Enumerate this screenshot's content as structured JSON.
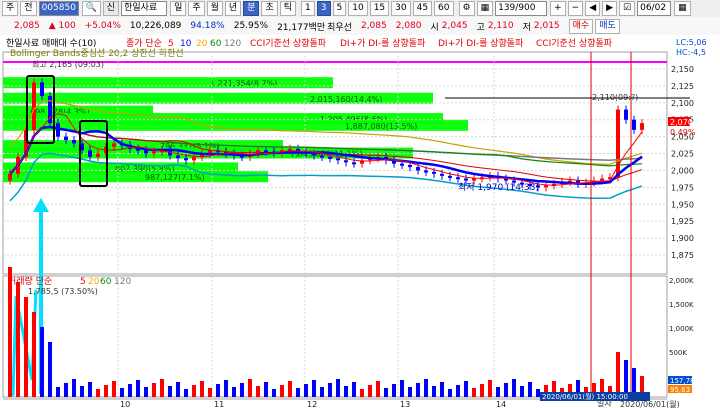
{
  "toolbar": {
    "market_label": "주",
    "exchange_label": "전",
    "code_value": "005850",
    "company_badge": "신",
    "company_name": "한일사료",
    "period_buttons": [
      "일",
      "주",
      "월",
      "년",
      "분",
      "초",
      "틱"
    ],
    "selected_period": "분",
    "minute_buttons": [
      "1",
      "3",
      "5",
      "10",
      "15",
      "30",
      "45",
      "60"
    ],
    "selected_minute": "3",
    "count_value": "139/900",
    "date_value": "06/02"
  },
  "quote": {
    "price": "2,085",
    "change": "▲ 100",
    "change_pct": "+5.04%",
    "volume": "10,226,089",
    "ratio": "94.18%",
    "turnover": "25.95%",
    "amount": "21,177백만",
    "min_label": "최우선",
    "ask": "2,085",
    "bid": "2,080",
    "open_label": "시",
    "open": "2,045",
    "high_label": "고",
    "high": "2,110",
    "low_label": "저",
    "low": "2,015",
    "buy_btn": "매수",
    "sell_btn": "매도"
  },
  "legend": {
    "title": "한일사료 매매대 수(10)",
    "ma_label": "종가 단순",
    "ma_periods": [
      "5",
      "10",
      "20",
      "60",
      "120"
    ],
    "indicators": [
      "CCI기준선 상향돌파",
      "DI+가 DI-를 상향돌파",
      "DI+가 DI-를 상향돌파",
      "CCI기준선 상향돌파"
    ],
    "bollinger": "Bollinger Bands중심선 20,2 상한선 하한선",
    "high_note": "최고 2,165 (09:03)",
    "low_note": "최저 1,970 (14:33)",
    "top_right": [
      "LC:5,06",
      "HC:-4,5"
    ]
  },
  "volume_legend": {
    "label": "거래량 단순",
    "periods": [
      "5",
      "20",
      "60",
      "120"
    ],
    "note": "1,785,5 (73.50%)"
  },
  "colors": {
    "green": "#00ff00",
    "up": "#ff0000",
    "down": "#0000ff",
    "ma5": "#ff0000",
    "ma10": "#0000ff",
    "ma20": "#ffa500",
    "ma60": "#0a8a0a",
    "ma120": "#7a7a7a",
    "bb_upper": "#c8a000",
    "bb_mid": "#e00000",
    "bb_lower": "#00a0c8",
    "magenta": "#ff00ff"
  },
  "price_axis": [
    "2,150",
    "2,125",
    "2,100",
    "2,075",
    "2,050",
    "2,025",
    "2,000",
    "1,975",
    "1,950",
    "1,925",
    "1,900",
    "1,875"
  ],
  "volume_axis": [
    "2,000K",
    "1,500K",
    "1,000K",
    "500K"
  ],
  "time_axis": [
    "10",
    "11",
    "12",
    "13",
    "14"
  ],
  "time_footer": [
    "2020/06/01(월) 15:00:00",
    "2020/06/01(월)"
  ],
  "footer_label": "일자",
  "last_price_tag": "2,070",
  "last_pct_tag": "0.49%",
  "volume_tags": [
    "157,78",
    "95,63"
  ],
  "volume_profile": [
    {
      "price": "2,129",
      "text": "1,221,354(8.7%)"
    },
    {
      "price": "2,106",
      "text": "2,015,160(14.4%)"
    },
    {
      "price": "2,087",
      "text": "698,578(4.3%)"
    },
    {
      "price": "2,076",
      "text": "1,205,496(8.6%)"
    },
    {
      "price": "2,066",
      "text": "1,887,080(13.5%)"
    },
    {
      "price": "2,036",
      "text": "786,331(5.1%)"
    },
    {
      "price": "2,025",
      "text": "1,503,086(11.1%)"
    },
    {
      "price": "2,003",
      "text": "807,390(5.8%)"
    },
    {
      "price": "1,990",
      "text": "987,127(7.1%)"
    }
  ],
  "right_note": "2,110(09:?)"
}
